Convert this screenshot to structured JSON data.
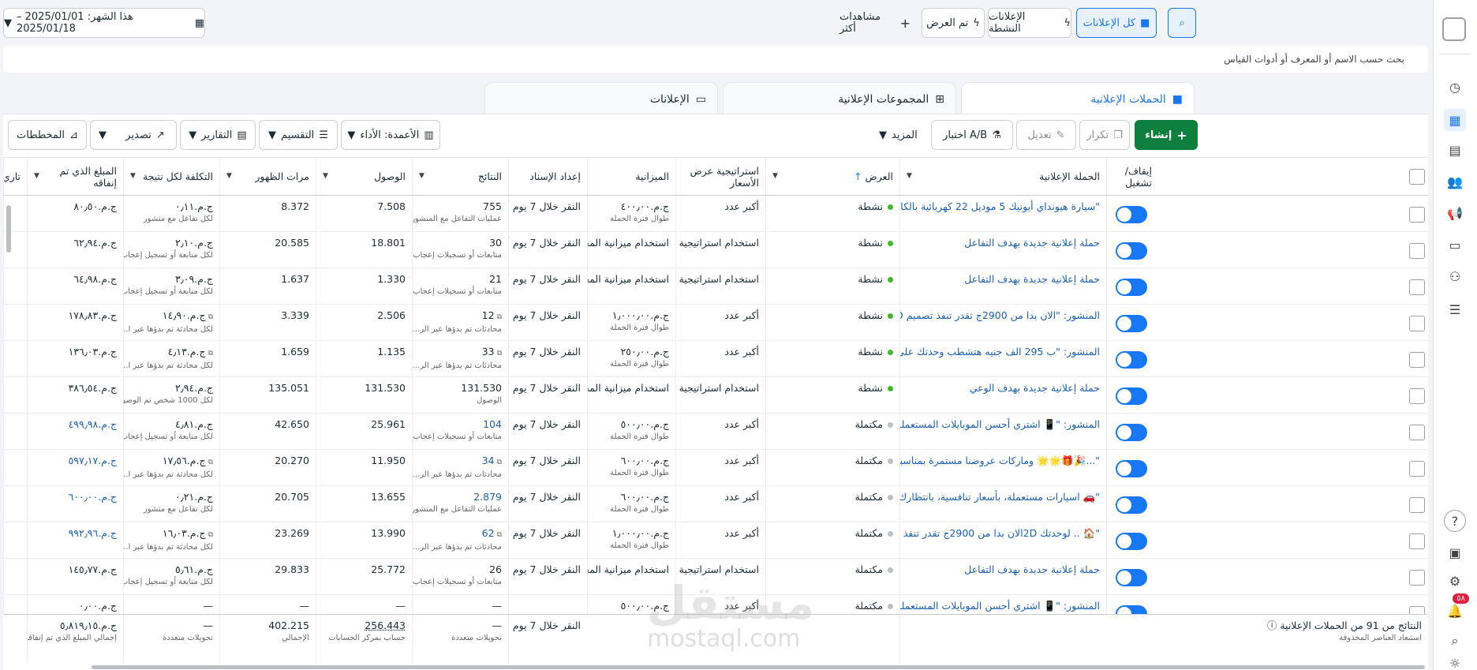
{
  "topbar": {
    "date_label": "هذا الشهر: 2025/01/01 – 2025/01/18",
    "more_views": "مشاهدات أكثر",
    "tab_all_ads": "كل الإعلانات",
    "tab_active_ads": "الإعلانات النشطة",
    "tab_shown": "تم العرض"
  },
  "search": {
    "placeholder": "بحث حسب الاسم أو المعرف أو أدوات القياس"
  },
  "tabs": {
    "campaigns": "الحملات الإعلانية",
    "adsets": "المجموعات الإعلانية",
    "ads": "الإعلانات"
  },
  "actions": {
    "create": "إنشاء",
    "duplicate": "تكرار",
    "edit": "تعديل",
    "ab_test": "اختبار A/B",
    "more": "المزيد",
    "columns": "الأعمدة: الأداء",
    "breakdown": "التقسيم",
    "reports": "التقارير",
    "export": "تصدير",
    "charts": "المخططات"
  },
  "columns": {
    "toggle": "إيقاف/ تشغيل",
    "campaign": "الحملة الإعلانية",
    "delivery": "العرض",
    "bid": "استراتيجية عرض الأسعار",
    "budget": "الميزانية",
    "attribution": "إعداد الإسناد",
    "results": "النتائج",
    "reach": "الوصول",
    "impressions": "مرات الظهور",
    "cost": "التكلفة لكل نتيجة",
    "spent": "المبلغ الذي تم إنفاقه",
    "end": "تاري"
  },
  "rows": [
    {
      "name": "\"سيارة هيونداي أيونيك 5 موديل 22 كهربائية بالكامل\" :Post",
      "status": "نشطة",
      "active": true,
      "bid": "أكبر عدد",
      "budget": "ج.م.٤٠٠٫٠٠",
      "budget_sub": "طوال فترة الحملة",
      "attr": "النقر خلال 7 يوم أو...",
      "result": "755",
      "result_sub": "عمليات التفاعل مع المنشور",
      "reach": "7.508",
      "imp": "8.372",
      "cost": "ج.م.٠٫١١",
      "cost_sub": "لكل تفاعل مع منشور",
      "spent": "ج.م.٨٠٫٥٠",
      "spent_link": false
    },
    {
      "name": "حملة إعلانية جديدة بهدف التفاعل",
      "status": "نشطة",
      "active": true,
      "bid": "استخدام استراتيجية عر...",
      "budget": "استخدام ميزانية المجمو...",
      "budget_sub": "",
      "attr": "النقر خلال 7 يوم أو...",
      "result": "30",
      "result_sub": "متابعات أو تسجيلات إعجاب",
      "reach": "18.801",
      "imp": "20.585",
      "cost": "ج.م.٢٫١٠",
      "cost_sub": "لكل متابعة أو تسجيل إعجاب",
      "spent": "ج.م.٦٢٫٩٤",
      "spent_link": false
    },
    {
      "name": "حملة إعلانية جديدة بهدف التفاعل",
      "status": "نشطة",
      "active": true,
      "bid": "استخدام استراتيجية عر...",
      "budget": "استخدام ميزانية المجمو...",
      "budget_sub": "",
      "attr": "النقر خلال 7 يوم أو...",
      "result": "21",
      "result_sub": "متابعات أو تسجيلات إعجاب",
      "reach": "1.330",
      "imp": "1.637",
      "cost": "ج.م.٣٫٠٩",
      "cost_sub": "لكل متابعة أو تسجيل إعجاب",
      "spent": "ج.م.٦٤٫٩٨",
      "spent_link": false
    },
    {
      "name": "المنشور: \"الان بدا من 2900ج تقدر تنفذ تصميم 2D لوحدتك .. ..",
      "status": "نشطة",
      "active": true,
      "bid": "أكبر عدد",
      "budget": "ج.م.١٫٠٠٠٫٠٠",
      "budget_sub": "طوال فترة الحملة",
      "attr": "النقر خلال 7 يوم أو...",
      "result": "12",
      "result_sub": "محادثات تم بدؤها عبر الر...",
      "reach": "2.506",
      "imp": "3.339",
      "cost": "ج.م.١٤٫٩٠",
      "cost_sub": "لكل محادثة تم بدؤها عبر ا...",
      "spent": "ج.م.١٧٨٫٨٣",
      "spent_link": false
    },
    {
      "name": "المنشور: \"ب 295 الف جنيه هتشطب وحدتك على المفتاح 🙏",
      "status": "نشطة",
      "active": true,
      "bid": "أكبر عدد",
      "budget": "ج.م.٢٥٠٫٠٠",
      "budget_sub": "طوال فترة الحملة",
      "attr": "النقر خلال 7 يوم أو...",
      "result": "33",
      "result_sub": "محادثات تم بدؤها عبر الر...",
      "reach": "1.135",
      "imp": "1.659",
      "cost": "ج.م.٤٫١٣",
      "cost_sub": "لكل محادثة تم بدؤها عبر ا...",
      "spent": "ج.م.١٣٦٫٠٣",
      "spent_link": false
    },
    {
      "name": "حملة إعلانية جديدة بهدف الوعي",
      "status": "نشطة",
      "active": true,
      "bid": "استخدام استراتيجية عر...",
      "budget": "استخدام ميزانية المجمو...",
      "budget_sub": "",
      "attr": "النقر خلال 7 يوم أو...",
      "result": "131.530",
      "result_sub": "الوصول",
      "reach": "131.530",
      "imp": "135.051",
      "cost": "ج.م.٢٫٩٤",
      "cost_sub": "لكل 1000 شخص تم الوصول...",
      "spent": "ج.م.٣٨٦٫٥٤",
      "spent_link": false
    },
    {
      "name": "المنشور: \"📱 اشتري أحسن الموبايلات المستعملة بجودة عالية...\"",
      "status": "مكتملة",
      "active": false,
      "bid": "أكبر عدد",
      "budget": "ج.م.٥٠٠٫٠٠",
      "budget_sub": "طوال فترة الحملة",
      "attr": "النقر خلال 7 يوم أو...",
      "result": "104",
      "result_sub": "متابعات أو تسجيلات إعجاب",
      "reach": "25.961",
      "imp": "42.650",
      "cost": "ج.م.٤٫٨١",
      "cost_sub": "لكل متابعة أو تسجيل إعجاب",
      "spent": "ج.م.٤٩٩٫٩٨",
      "spent_link": true
    },
    {
      "name": "\"...🎉🎁🌟🌟 وماركات عروضنا مستمرة بمناسبة يناير...",
      "status": "مكتملة",
      "active": false,
      "bid": "أكبر عدد",
      "budget": "ج.م.٦٠٠٫٠٠",
      "budget_sub": "طوال فترة الحملة",
      "attr": "النقر خلال 7 يوم أو...",
      "result": "34",
      "result_sub": "محادثات تم بدؤها عبر الر...",
      "reach": "11.950",
      "imp": "20.270",
      "cost": "ج.م.١٧٫٥٦",
      "cost_sub": "لكل محادثة تم بدؤها عبر ا...",
      "spent": "ج.م.٥٩٧٫١٧",
      "spent_link": true
    },
    {
      "name": "\"🚗 اسيارات مستعملة، بأسعار تنافسية، بانتظارك 🚗\" :Post",
      "status": "مكتملة",
      "active": false,
      "bid": "أكبر عدد",
      "budget": "ج.م.٦٠٠٫٠٠",
      "budget_sub": "طوال فترة الحملة",
      "attr": "النقر خلال 7 يوم أو...",
      "result": "2.879",
      "result_sub": "عمليات التفاعل مع المنشور",
      "reach": "13.655",
      "imp": "20.705",
      "cost": "ج.م.٠٫٢١",
      "cost_sub": "لكل تفاعل مع منشور",
      "spent": "ج.م.٦٠٠٫٠٠",
      "spent_link": true
    },
    {
      "name": "\"🏠 .. لوحدتك 2Dالان بدا من 2900ج تقدر تنفذ تصميم :st",
      "status": "مكتملة",
      "active": false,
      "bid": "أكبر عدد",
      "budget": "ج.م.١٫٠٠٠٫٠٠",
      "budget_sub": "طوال فترة الحملة",
      "attr": "النقر خلال 7 يوم أو...",
      "result": "62",
      "result_sub": "محادثات تم بدؤها عبر الر...",
      "reach": "13.990",
      "imp": "23.269",
      "cost": "ج.م.١٦٫٠٣",
      "cost_sub": "لكل محادثة تم بدؤها عبر ا...",
      "spent": "ج.م.٩٩٢٫٩٦",
      "spent_link": true
    },
    {
      "name": "حملة إعلانية جديدة بهدف التفاعل",
      "status": "مكتملة",
      "active": false,
      "bid": "استخدام استراتيجية عر...",
      "budget": "استخدام ميزانية المجمو...",
      "budget_sub": "",
      "attr": "النقر خلال 7 يوم أو...",
      "result": "26",
      "result_sub": "متابعات أو تسجيلات إعجاب",
      "reach": "25.772",
      "imp": "29.833",
      "cost": "ج.م.٥٫٦١",
      "cost_sub": "لكل متابعة أو تسجيل إعجاب",
      "spent": "ج.م.١٤٥٫٧٧",
      "spent_link": false
    },
    {
      "name": "المنشور: \"📱 اشتري أحسن الموبايلات المستعملة بجودة عالية...\"",
      "status": "مكتملة",
      "active": false,
      "bid": "أكبر عدد",
      "budget": "ج.م.٥٠٠٫٠٠",
      "budget_sub": "",
      "attr": "",
      "result": "—",
      "result_sub": "",
      "reach": "—",
      "imp": "—",
      "cost": "—",
      "cost_sub": "",
      "spent": "ج.م.٠٫٠٠",
      "spent_link": false
    }
  ],
  "footer": {
    "label": "النتائج من 91 من الحملات الإعلانية",
    "sub": "استبعاد العناصر المحذوفة",
    "attr": "النقر خلال 7 يوم أو...",
    "results": "—",
    "results_sub": "تحويلات متعددة",
    "reach": "256.443",
    "reach_sub": "حساب بمركز الحسابات",
    "imp": "402.215",
    "imp_sub": "الإجمالي",
    "cost": "—",
    "cost_sub": "تحويلات متعددة",
    "spent": "ج.م.٥٫٨١٩٫١٥",
    "spent_sub": "إجمالي المبلغ الذي تم إنفاقه"
  },
  "rail": {
    "notification_count": "٥٨"
  },
  "watermark": {
    "brand": "مستقل",
    "url": "mostaql.com"
  },
  "colors": {
    "accent": "#1877f2",
    "create": "#0f7f3d",
    "active_dot": "#42b72a",
    "done_dot": "#bcc0c4"
  }
}
